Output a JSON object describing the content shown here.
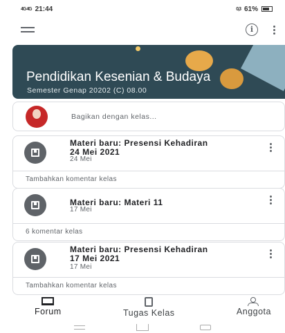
{
  "status_bar": {
    "time": "21:44",
    "signal": "4G 4G",
    "battery": "61%",
    "speed": "0,3"
  },
  "class": {
    "title": "Pendidikan Kesenian & Budaya",
    "subtitle": "Semester Genap 20202 (C) 08.00"
  },
  "share": {
    "placeholder": "Bagikan dengan kelas..."
  },
  "posts": [
    {
      "title": "Materi baru: Presensi Kehadiran 24 Mei 2021",
      "date": "24 Mei",
      "footer": "Tambahkan komentar kelas"
    },
    {
      "title": "Materi baru: Materi 11",
      "date": "17 Mei",
      "footer": "6 komentar kelas"
    },
    {
      "title": "Materi baru: Presensi Kehadiran 17 Mei 2021",
      "date": "17 Mei",
      "footer": "Tambahkan komentar kelas"
    }
  ],
  "bottom_nav": [
    {
      "label": "Forum",
      "icon": "forum-icon",
      "active": true
    },
    {
      "label": "Tugas Kelas",
      "icon": "classwork-icon",
      "active": false
    },
    {
      "label": "Anggota",
      "icon": "people-icon",
      "active": false
    }
  ]
}
